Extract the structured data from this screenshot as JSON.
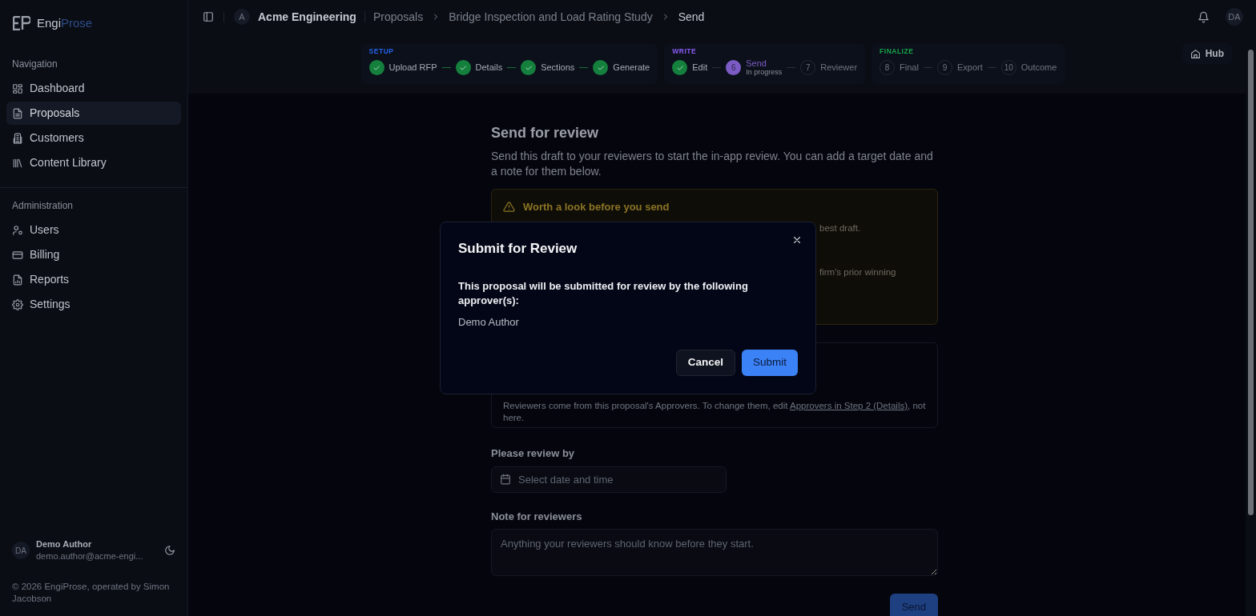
{
  "brand": {
    "part_1": "Engi",
    "part_2": "Prose"
  },
  "sidebar": {
    "sections": [
      {
        "title": "Navigation",
        "items": [
          {
            "label": "Dashboard",
            "selected": false
          },
          {
            "label": "Proposals",
            "selected": true
          },
          {
            "label": "Customers",
            "selected": false
          },
          {
            "label": "Content Library",
            "selected": false
          }
        ]
      },
      {
        "title": "Administration",
        "items": [
          {
            "label": "Users",
            "selected": false
          },
          {
            "label": "Billing",
            "selected": false
          },
          {
            "label": "Reports",
            "selected": false
          },
          {
            "label": "Settings",
            "selected": false
          }
        ]
      }
    ],
    "user": {
      "initials": "DA",
      "name": "Demo Author",
      "email": "demo.author@acme-engi..."
    },
    "footer": "© 2026 EngiProse, operated by Simon Jacobson"
  },
  "header": {
    "org_initial": "A",
    "org_name": "Acme Engineering",
    "breadcrumbs": [
      "Proposals",
      "Bridge Inspection and Load Rating Study",
      "Send"
    ],
    "avatar": "DA"
  },
  "stepper": {
    "groups": [
      {
        "title": "SETUP",
        "color": "#2563eb",
        "steps": [
          {
            "label": "Upload RFP",
            "completed": true,
            "active": false
          },
          {
            "label": "Details",
            "completed": true,
            "active": false
          },
          {
            "label": "Sections",
            "completed": true,
            "active": false
          },
          {
            "label": "Generate",
            "completed": true,
            "active": false
          }
        ]
      },
      {
        "title": "WRITE",
        "color": "#8b5cf6",
        "steps": [
          {
            "label": "Edit",
            "completed": true,
            "active": false
          },
          {
            "number": "6",
            "label": "Send",
            "note": "In progress",
            "completed": false,
            "active": true
          },
          {
            "number": "7",
            "label": "Reviewer",
            "completed": false,
            "active": false
          }
        ]
      },
      {
        "title": "FINALIZE",
        "color": "#16a34a",
        "steps": [
          {
            "number": "8",
            "label": "Final",
            "completed": false,
            "active": false
          },
          {
            "number": "9",
            "label": "Export",
            "completed": false,
            "active": false
          },
          {
            "number": "10",
            "label": "Outcome",
            "completed": false,
            "active": false
          }
        ]
      }
    ],
    "hub": "Hub"
  },
  "page": {
    "title": "Send for review",
    "intro": "Send this draft to your reviewers to start the in-app review. You can add a target date and a note for them below.",
    "warning": {
      "title": "Worth a look before you send",
      "fragments": [
        "best draft.",
        "firm's prior winning"
      ]
    },
    "reviewers_note": {
      "text": "Reviewers come from this proposal's Approvers. To change them, edit ",
      "link": "Approvers in Step 2 (Details)",
      "after": ", not here."
    },
    "date": {
      "label": "Please review by",
      "placeholder": "Select date and time"
    },
    "note": {
      "label": "Note for reviewers",
      "placeholder": "Anything your reviewers should know before they start."
    },
    "send": "Send"
  },
  "dialog": {
    "title": "Submit for Review",
    "message": "This proposal will be submitted for review by the following approver(s):",
    "approvers": [
      "Demo Author"
    ],
    "buttons": [
      "Cancel",
      "Submit"
    ]
  }
}
